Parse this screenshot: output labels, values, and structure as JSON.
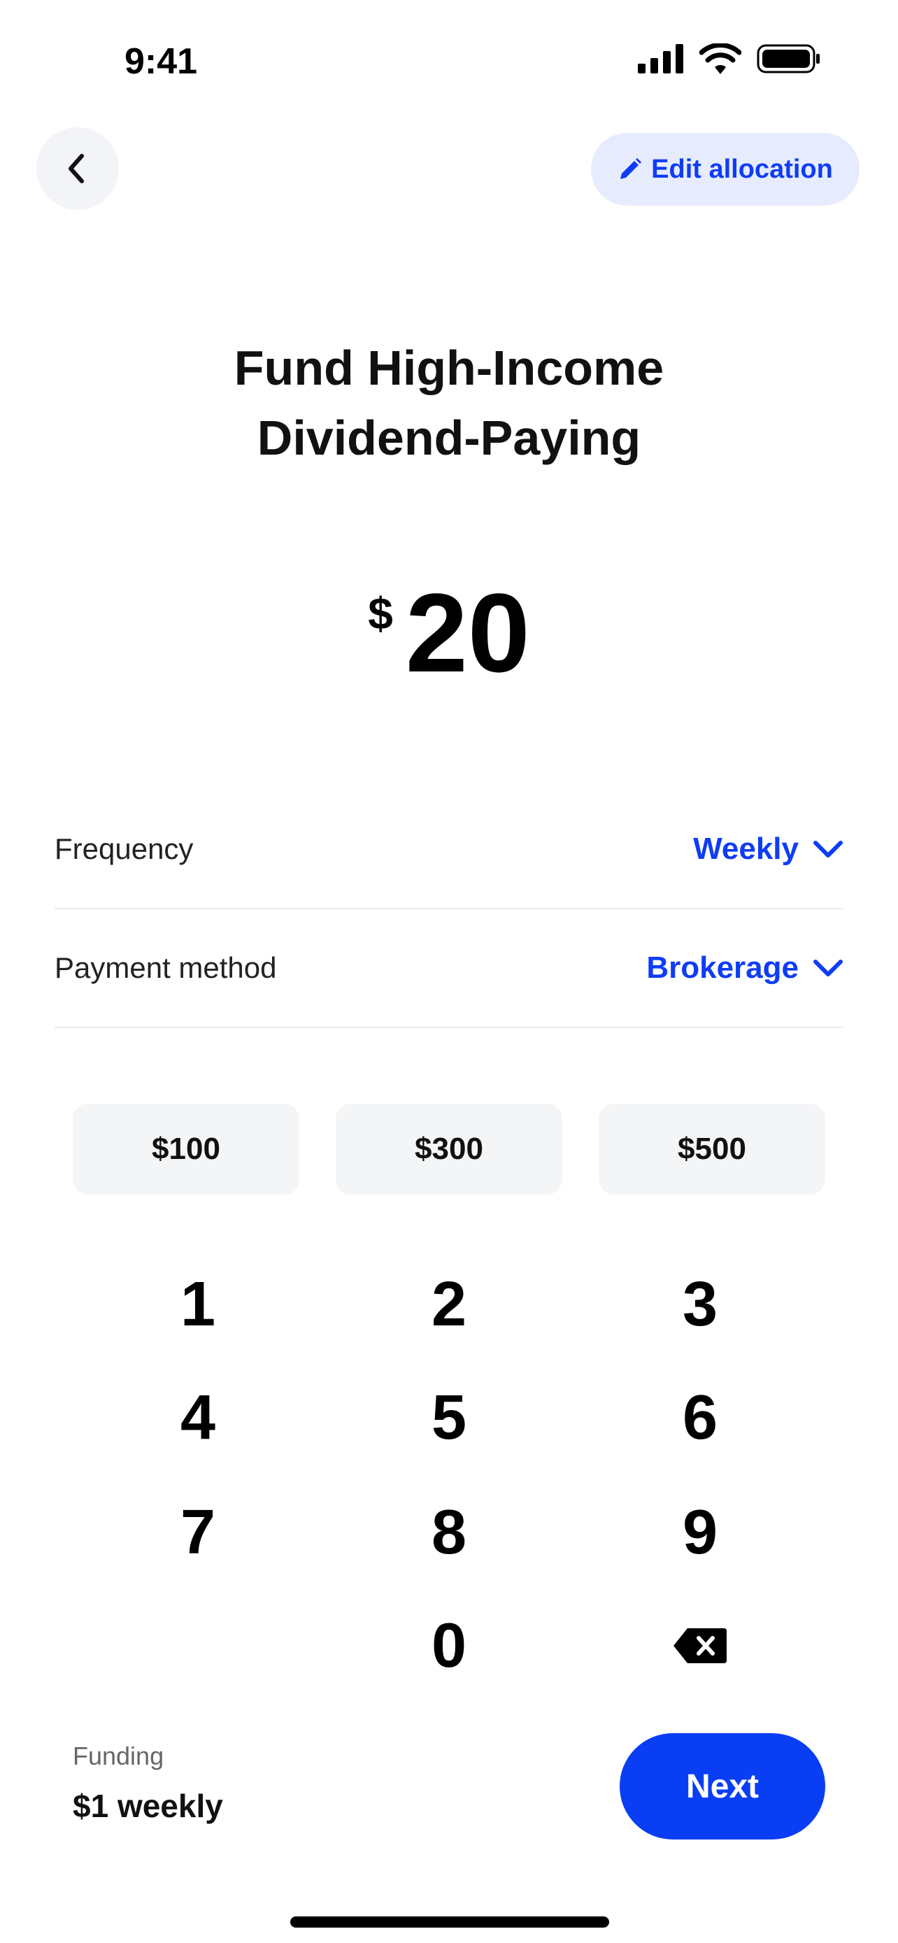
{
  "status_bar": {
    "time": "9:41"
  },
  "header": {
    "edit_allocation_label": "Edit allocation"
  },
  "title": {
    "line1": "Fund High-Income",
    "line2": "Dividend-Paying"
  },
  "amount": {
    "currency": "$",
    "value": "20"
  },
  "settings": [
    {
      "label": "Frequency",
      "value": "Weekly"
    },
    {
      "label": "Payment method",
      "value": "Brokerage"
    }
  ],
  "presets": [
    "$100",
    "$300",
    "$500"
  ],
  "keypad": [
    "1",
    "2",
    "3",
    "4",
    "5",
    "6",
    "7",
    "8",
    "9",
    "0"
  ],
  "footer": {
    "funding_label": "Funding",
    "funding_value": "$1 weekly",
    "next_label": "Next"
  },
  "colors": {
    "accent": "#0A3EF5",
    "accent_light": "#E6ECFD",
    "chip_bg": "#F4F5F7"
  },
  "icons": [
    "cellular-signal-icon",
    "wifi-icon",
    "battery-icon",
    "chevron-left-icon",
    "pencil-icon",
    "chevron-down-icon",
    "backspace-icon"
  ]
}
